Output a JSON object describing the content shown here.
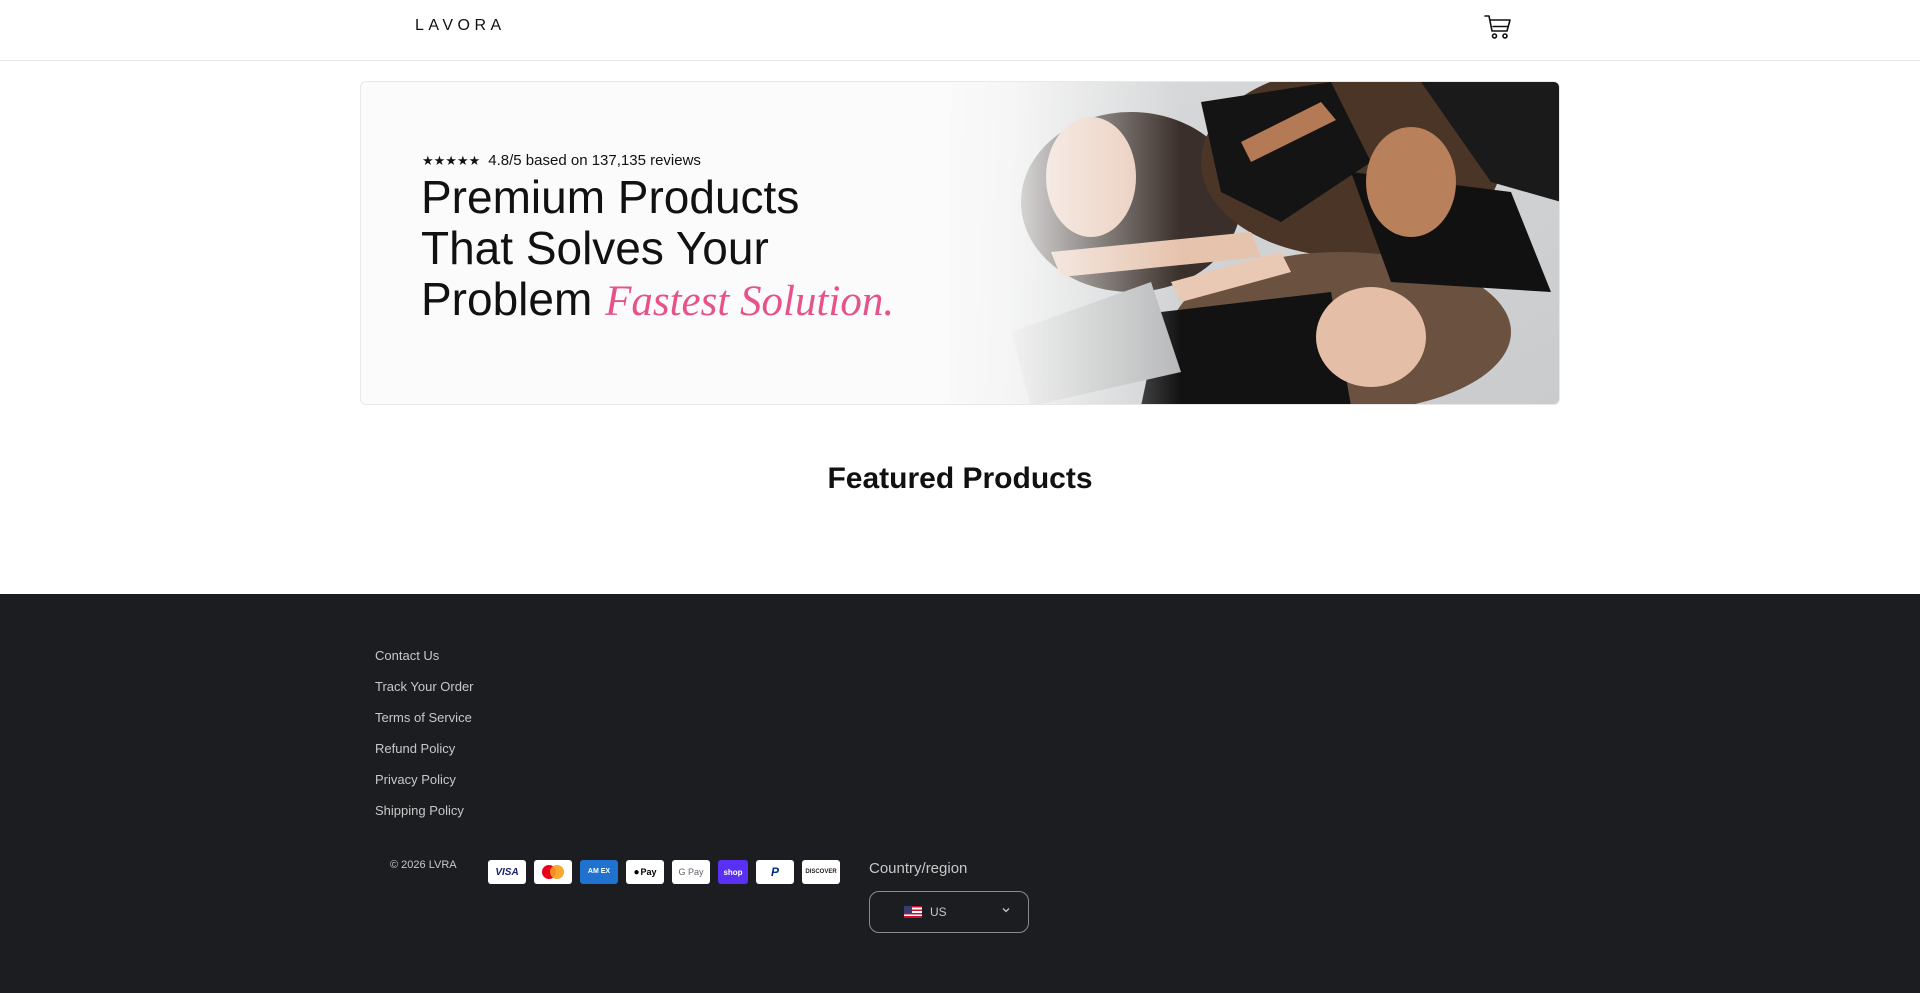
{
  "header": {
    "logo": "LAVORA",
    "cart_icon": "cart-icon"
  },
  "hero": {
    "stars": "★★★★★",
    "rating_text": "4.8/5 based on 137,135 reviews",
    "headline_line1": "Premium Products",
    "headline_line2": "That Solves Your",
    "headline_line3": "Problem",
    "headline_accent": "Fastest Solution.",
    "accent_color": "#e5538a"
  },
  "featured": {
    "title": "Featured Products"
  },
  "footer": {
    "links": [
      "Contact Us",
      "Track Your Order",
      "Terms of Service",
      "Refund Policy",
      "Privacy Policy",
      "Shipping Policy"
    ],
    "copyright": "© 2026 LVRA",
    "payment_methods": [
      {
        "name": "visa",
        "label": "VISA"
      },
      {
        "name": "mastercard",
        "label": ""
      },
      {
        "name": "amex",
        "label": "AM EX"
      },
      {
        "name": "apple-pay",
        "label": "Pay"
      },
      {
        "name": "google-pay",
        "label": "G Pay"
      },
      {
        "name": "shop-pay",
        "label": "shop"
      },
      {
        "name": "paypal",
        "label": "P"
      },
      {
        "name": "discover",
        "label": "DISCOVER"
      }
    ],
    "region_label": "Country/region",
    "region_value": "US",
    "background_color": "#1c1d20"
  }
}
